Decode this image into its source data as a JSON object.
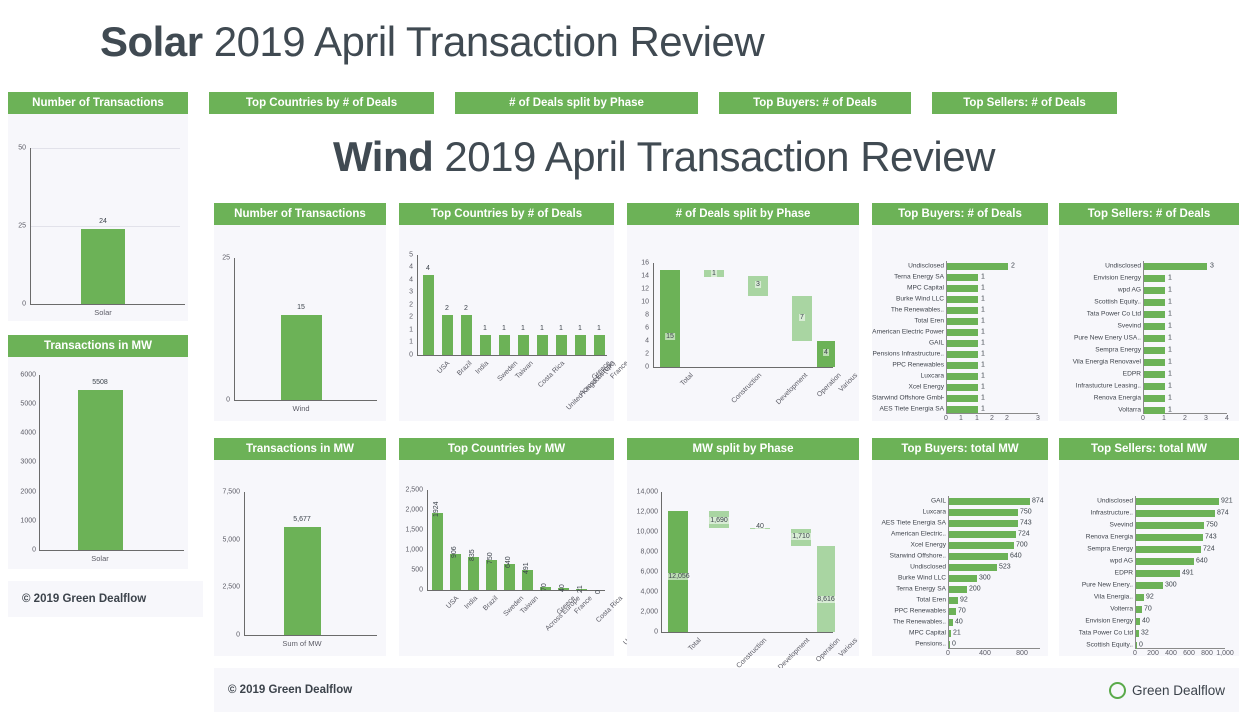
{
  "solar": {
    "title_bold": "Solar",
    "title_rest": " 2019 April Transaction Review",
    "tabs": [
      "Number of Transactions",
      "Top Countries by # of Deals",
      "# of Deals split by Phase",
      "Top Buyers: # of Deals",
      "Top Sellers: # of Deals"
    ],
    "footer": "© 2019 Green Dealflow",
    "panels": {
      "transactions": "Number of Transactions",
      "mw": "Transactions in MW"
    }
  },
  "wind": {
    "title_bold": "Wind",
    "title_rest": " 2019 April Transaction Review",
    "footer": "© 2019 Green Dealflow",
    "brand": "Green Dealflow",
    "panels": {
      "transactions": "Number of Transactions",
      "countries_deals": "Top Countries by # of Deals",
      "deals_phase": "# of Deals split by Phase",
      "buyers_deals": "Top Buyers: # of Deals",
      "sellers_deals": "Top Sellers: # of Deals",
      "mw": "Transactions in MW",
      "countries_mw": "Top Countries by MW",
      "mw_phase": "MW split by Phase",
      "buyers_mw": "Top Buyers: total MW",
      "sellers_mw": "Top Sellers: total MW"
    }
  },
  "colors": {
    "accent_green": "#6cb257",
    "light_green": "#a9d5a2",
    "panel_bg": "#f7f7fb",
    "title_gray": "#404a52"
  },
  "chart_data": [
    {
      "id": "solar_transactions",
      "type": "bar",
      "title": "Number of Transactions",
      "categories": [
        "Solar"
      ],
      "values": [
        24
      ],
      "labels": [
        "24"
      ],
      "yticks": [
        0,
        25,
        50
      ],
      "ytick_labels": [
        "0",
        "25",
        "50"
      ],
      "ylim": [
        0,
        50
      ],
      "xlabel": "",
      "ylabel": ""
    },
    {
      "id": "solar_mw",
      "type": "bar",
      "title": "Transactions in MW",
      "categories": [
        "Solar"
      ],
      "values": [
        5508
      ],
      "labels": [
        "5508"
      ],
      "yticks": [
        0,
        1000,
        2000,
        3000,
        4000,
        5000,
        6000
      ],
      "ytick_labels": [
        "0",
        "1000",
        "2000",
        "3000",
        "4000",
        "5000",
        "6000"
      ],
      "ylim": [
        0,
        6000
      ],
      "xlabel": "",
      "ylabel": ""
    },
    {
      "id": "wind_transactions",
      "type": "bar",
      "title": "Number of Transactions",
      "categories": [
        "Wind"
      ],
      "values": [
        15
      ],
      "labels": [
        "15"
      ],
      "yticks": [
        0,
        25
      ],
      "ytick_labels": [
        "0",
        "25"
      ],
      "ylim": [
        0,
        25
      ],
      "xlabel": "",
      "ylabel": ""
    },
    {
      "id": "wind_countries_deals",
      "type": "bar",
      "title": "Top Countries by # of Deals",
      "categories": [
        "USA",
        "Brazil",
        "India",
        "Sweden",
        "Taiwan",
        "Costa Rica",
        "United Kingdom (UK)",
        "Across Europe",
        "Greece",
        "France"
      ],
      "values": [
        4,
        2,
        2,
        1,
        1,
        1,
        1,
        1,
        1,
        1
      ],
      "labels": [
        "4",
        "2",
        "2",
        "1",
        "1",
        "1",
        "1",
        "1",
        "1",
        "1"
      ],
      "yticks": [
        0,
        1,
        1.5,
        2,
        2.5,
        3,
        3.5,
        4,
        5
      ],
      "ytick_labels": [
        "0",
        "1",
        "1",
        "2",
        "2",
        "3",
        "4",
        "4",
        "5"
      ],
      "ylim": [
        0,
        5
      ],
      "xlabel": "",
      "ylabel": ""
    },
    {
      "id": "wind_deals_phase",
      "type": "waterfall",
      "title": "# of Deals split by Phase",
      "categories": [
        "Total",
        "Construction",
        "Development",
        "Operation",
        "Various"
      ],
      "values": [
        15,
        1,
        3,
        7,
        4
      ],
      "labels": [
        "15",
        "1",
        "3",
        "7",
        "4"
      ],
      "bases": [
        0,
        14,
        11,
        4,
        0
      ],
      "tops": [
        15,
        15,
        14,
        11,
        4
      ],
      "shades": [
        "dark",
        "light",
        "light",
        "light",
        "dark"
      ],
      "yticks": [
        0,
        2,
        4,
        6,
        8,
        10,
        12,
        14,
        16
      ],
      "ytick_labels": [
        "0",
        "2",
        "4",
        "6",
        "8",
        "10",
        "12",
        "14",
        "16"
      ],
      "ylim": [
        0,
        16
      ],
      "xlabel": "",
      "ylabel": ""
    },
    {
      "id": "wind_buyers_deals",
      "type": "bar-h",
      "title": "Top Buyers: # of Deals",
      "categories": [
        "Undisclosed",
        "Terna Energy SA",
        "MPC Capital",
        "Burke Wind LLC",
        "The Renewables..",
        "Total Eren",
        "American Electric Power",
        "GAIL",
        "Pensions Infrastructure..",
        "PPC Renewables",
        "Luxcara",
        "Xcel Energy",
        "Starwind Offshore GmbH",
        "AES Tiete Energia SA"
      ],
      "values": [
        2,
        1,
        1,
        1,
        1,
        1,
        1,
        1,
        1,
        1,
        1,
        1,
        1,
        1
      ],
      "labels": [
        "2",
        "1",
        "1",
        "1",
        "1",
        "1",
        "1",
        "1",
        "1",
        "1",
        "1",
        "1",
        "1",
        "1"
      ],
      "xticks": [
        0,
        0.5,
        1,
        1.5,
        2,
        3
      ],
      "xtick_labels": [
        "0",
        "1",
        "1",
        "2",
        "2",
        "3"
      ],
      "xlim": [
        0,
        3
      ],
      "xlabel": "",
      "ylabel": ""
    },
    {
      "id": "wind_sellers_deals",
      "type": "bar-h",
      "title": "Top Sellers: # of Deals",
      "categories": [
        "Undisclosed",
        "Envision Energy",
        "wpd AG",
        "Scottish Equity..",
        "Tata Power Co Ltd",
        "Svevind",
        "Pure New Enery USA..",
        "Sempra Energy",
        "Vila Energia Renovavel",
        "EDPR",
        "Infrastucture Leasing..",
        "Renova Energia",
        "Voltarra"
      ],
      "values": [
        3,
        1,
        1,
        1,
        1,
        1,
        1,
        1,
        1,
        1,
        1,
        1,
        1
      ],
      "labels": [
        "3",
        "1",
        "1",
        "1",
        "1",
        "1",
        "1",
        "1",
        "1",
        "1",
        "1",
        "1",
        "1"
      ],
      "xticks": [
        0,
        1,
        2,
        3,
        4
      ],
      "xtick_labels": [
        "0",
        "1",
        "2",
        "3",
        "4"
      ],
      "xlim": [
        0,
        4
      ],
      "xlabel": "",
      "ylabel": ""
    },
    {
      "id": "wind_mw",
      "type": "bar",
      "title": "Transactions in MW",
      "categories": [
        "Sum of MW"
      ],
      "values": [
        5677
      ],
      "labels": [
        "5,677"
      ],
      "yticks": [
        0,
        2500,
        5000,
        7500
      ],
      "ytick_labels": [
        "0",
        "2,500",
        "5,000",
        "7,500"
      ],
      "ylim": [
        0,
        7500
      ],
      "xlabel": "",
      "ylabel": ""
    },
    {
      "id": "wind_countries_mw",
      "type": "bar",
      "title": "Top Countries by MW",
      "categories": [
        "USA",
        "India",
        "Brazil",
        "Sweden",
        "Taiwan",
        "Across Europe",
        "Greece",
        "France",
        "Costa Rica",
        "United Kingdom (UK)"
      ],
      "values": [
        1924,
        906,
        835,
        750,
        640,
        491,
        70,
        40,
        21,
        0
      ],
      "labels": [
        "1924",
        "906",
        "835",
        "750",
        "640",
        "491",
        "70",
        "40",
        "21",
        "0"
      ],
      "yticks": [
        0,
        500,
        1000,
        1500,
        2000,
        2500
      ],
      "ytick_labels": [
        "0",
        "500",
        "1,000",
        "1,500",
        "2,000",
        "2,500"
      ],
      "ylim": [
        0,
        2500
      ],
      "xlabel": "",
      "ylabel": ""
    },
    {
      "id": "wind_mw_phase",
      "type": "waterfall",
      "title": "MW split by Phase",
      "categories": [
        "Total",
        "Construction",
        "Development",
        "Operation",
        "Various"
      ],
      "values": [
        12056,
        1690,
        40,
        1710,
        8616
      ],
      "labels": [
        "12,056",
        "1,690",
        "40",
        "1,710",
        "8,616"
      ],
      "bases": [
        0,
        10366,
        10326,
        8616,
        0
      ],
      "tops": [
        12056,
        12056,
        10366,
        10326,
        8616
      ],
      "shades": [
        "dark",
        "light",
        "light",
        "light",
        "light"
      ],
      "yticks": [
        0,
        2000,
        4000,
        6000,
        8000,
        10000,
        12000,
        14000
      ],
      "ytick_labels": [
        "0",
        "2,000",
        "4,000",
        "6,000",
        "8,000",
        "10,000",
        "12,000",
        "14,000"
      ],
      "ylim": [
        0,
        14000
      ],
      "xlabel": "",
      "ylabel": ""
    },
    {
      "id": "wind_buyers_mw",
      "type": "bar-h",
      "title": "Top Buyers: total MW",
      "categories": [
        "GAIL",
        "Luxcara",
        "AES Tiete Energia SA",
        "American Electric..",
        "Xcel Energy",
        "Starwind Offshore..",
        "Undisclosed",
        "Burke Wind LLC",
        "Terna Energy SA",
        "Total Eren",
        "PPC Renewables",
        "The Renewables..",
        "MPC Capital",
        "Pensions.."
      ],
      "values": [
        874,
        750,
        743,
        724,
        700,
        640,
        523,
        300,
        200,
        92,
        70,
        40,
        21,
        0
      ],
      "labels": [
        "874",
        "750",
        "743",
        "724",
        "700",
        "640",
        "523",
        "300",
        "200",
        "92",
        "70",
        "40",
        "21",
        "0"
      ],
      "xticks": [
        0,
        400,
        800
      ],
      "xtick_labels": [
        "0",
        "400",
        "800"
      ],
      "xlim": [
        0,
        1000
      ],
      "xlabel": "",
      "ylabel": ""
    },
    {
      "id": "wind_sellers_mw",
      "type": "bar-h",
      "title": "Top Sellers: total MW",
      "categories": [
        "Undisclosed",
        "Infrastructure..",
        "Svevind",
        "Renova Energia",
        "Sempra Energy",
        "wpd AG",
        "EDPR",
        "Pure New Enery..",
        "Vila Energia..",
        "Volterra",
        "Envision Energy",
        "Tata Power Co Ltd",
        "Scottish Equity.."
      ],
      "values": [
        921,
        874,
        750,
        743,
        724,
        640,
        491,
        300,
        92,
        70,
        40,
        32,
        0
      ],
      "labels": [
        "921",
        "874",
        "750",
        "743",
        "724",
        "640",
        "491",
        "300",
        "92",
        "70",
        "40",
        "32",
        "0"
      ],
      "xticks": [
        0,
        200,
        400,
        600,
        800,
        1000
      ],
      "xtick_labels": [
        "0",
        "200",
        "400",
        "600",
        "800",
        "1,000"
      ],
      "xlim": [
        0,
        1000
      ],
      "xlabel": "",
      "ylabel": ""
    }
  ]
}
